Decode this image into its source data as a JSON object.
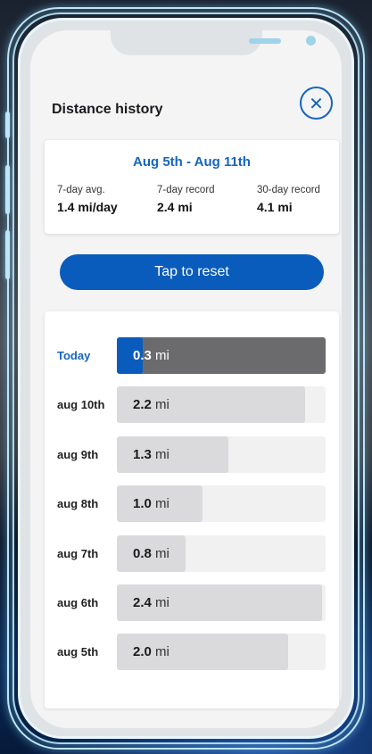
{
  "screen": {
    "title": "Distance history",
    "close_icon": "close-icon"
  },
  "summary": {
    "range": "Aug 5th - Aug 11th",
    "stats": [
      {
        "label": "7-day avg.",
        "value": "1.4 mi/day"
      },
      {
        "label": "7-day record",
        "value": "2.4 mi"
      },
      {
        "label": "30-day record",
        "value": "4.1 mi"
      }
    ]
  },
  "reset_button": {
    "label": "Tap to reset"
  },
  "history": {
    "unit": "mi",
    "max_value": 2.4,
    "rows": [
      {
        "label": "Today",
        "value": "0.3",
        "distance": 0.3,
        "is_today": true
      },
      {
        "label": "aug 10th",
        "value": "2.2",
        "distance": 2.2
      },
      {
        "label": "aug 9th",
        "value": "1.3",
        "distance": 1.3
      },
      {
        "label": "aug 8th",
        "value": "1.0",
        "distance": 1.0
      },
      {
        "label": "aug 7th",
        "value": "0.8",
        "distance": 0.8
      },
      {
        "label": "aug 6th",
        "value": "2.4",
        "distance": 2.4
      },
      {
        "label": "aug 5th",
        "value": "2.0",
        "distance": 2.0
      }
    ]
  },
  "colors": {
    "accent": "#0a5cbc",
    "today_track": "#6b6b6d",
    "bar_fill": "#dadadc",
    "bar_track": "#f1f1f2"
  }
}
